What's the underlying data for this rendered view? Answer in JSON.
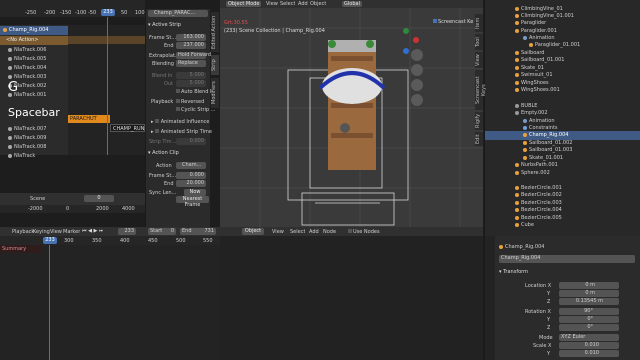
{
  "nla": {
    "ruler": [
      "-250",
      "-200",
      "-150",
      "-100",
      "-50",
      "0",
      "50",
      "100"
    ],
    "frame": "233",
    "tracks": [
      {
        "label": "Champ_Rig.004",
        "type": "object"
      },
      {
        "label": "<No Action>",
        "type": "action"
      },
      {
        "label": "NlaTrack.006",
        "type": "track"
      },
      {
        "label": "NlaTrack.005",
        "type": "track"
      },
      {
        "label": "NlaTrack.004",
        "type": "track"
      },
      {
        "label": "NlaTrack.003",
        "type": "track"
      },
      {
        "label": "NlaTrack.002",
        "type": "track"
      },
      {
        "label": "NlaTrack.001",
        "type": "track"
      },
      {
        "label": "NlaTrack.007",
        "type": "track"
      },
      {
        "label": "NlaTrack.009",
        "type": "track"
      },
      {
        "label": "NlaTrack.008",
        "type": "track"
      },
      {
        "label": "NlaTrack",
        "type": "track"
      }
    ],
    "strips": [
      "PARACHUT",
      "CHAMP_RUN.0"
    ],
    "overlay_g": "G",
    "overlay_space": "Spacebar",
    "bottom": {
      "snap": "Scene",
      "frame": "0",
      "ruler": [
        "-2000",
        "0",
        "2000",
        "4000"
      ]
    }
  },
  "strip_panel": {
    "header": "Champ_PARAC...",
    "active_strip": "Active Strip",
    "frame_start_label": "Frame St...",
    "frame_start": "163.000",
    "end_label": "End",
    "end": "237.000",
    "extrapolate_label": "Extrapolat...",
    "extrapolate": "Hold Forward",
    "blending_label": "Blending",
    "blending": "Replace",
    "blend_in_label": "Blend In",
    "blend_in": "5.000",
    "out_label": "Out",
    "out": "5.000",
    "auto_blend": "Auto Blend I...",
    "playback_label": "Playback",
    "reversed": "Reversed",
    "cyclic": "Cyclic Strip ...",
    "anim_influence": "Animated Influence",
    "anim_strip_time": "Animated Strip Time",
    "strip_time_label": "Strip Tim...",
    "strip_time": "0.000",
    "action_clip": "Action Clip",
    "action_label": "Action",
    "action_value": "Cham...",
    "frame_st2_label": "Frame St...",
    "frame_st2": "0.000",
    "end2_label": "End",
    "end2": "20.000",
    "sync_label": "Sync Len...",
    "now": "Now",
    "tabs": [
      "Edited Action",
      "Strip",
      "Modifiers"
    ],
    "nearest_frame": "Nearest Frame"
  },
  "viewport": {
    "mode": "Object Mode",
    "menus": [
      "View",
      "Select",
      "Add",
      "Object"
    ],
    "global": "Global",
    "info_time": "Grt:30.55",
    "info_line": "(233) Scene Collection | Champ_Rig.004",
    "screencast": "Screencast Ke"
  },
  "node_editor": {
    "type": "Object",
    "menus": [
      "View",
      "Select",
      "Add",
      "Node"
    ],
    "use_nodes": "Use Nodes"
  },
  "timeline": {
    "playback": "Playback",
    "keying": "Keying",
    "view": "View",
    "marker": "Marker",
    "frame": "233",
    "start_label": "Start",
    "start": "0",
    "end_label": "End",
    "end": "731",
    "ruler": [
      "200",
      "300",
      "350",
      "400",
      "450",
      "500",
      "550"
    ],
    "current_label": "233",
    "summary": "Summary"
  },
  "outliner": {
    "items": [
      {
        "label": "ClimbingVine_01",
        "indent": 0
      },
      {
        "label": "ClimbingVine_01.001",
        "indent": 0
      },
      {
        "label": "Paraglider",
        "indent": 0
      },
      {
        "label": "Paraglider.001",
        "indent": 0
      },
      {
        "label": "Animation",
        "indent": 1
      },
      {
        "label": "Paraglider_01.001",
        "indent": 2
      },
      {
        "label": "Sailboard",
        "indent": 0
      },
      {
        "label": "Sailboard_01.001",
        "indent": 0
      },
      {
        "label": "Skate_01",
        "indent": 0
      },
      {
        "label": "Swimsuit_01",
        "indent": 0
      },
      {
        "label": "WingShoes",
        "indent": 0
      },
      {
        "label": "WingShoes.001",
        "indent": 0
      },
      {
        "label": "",
        "indent": 0
      },
      {
        "label": "BUBLE",
        "indent": 0
      },
      {
        "label": "Empty.002",
        "indent": 0
      },
      {
        "label": "Animation",
        "indent": 1
      },
      {
        "label": "Constraints",
        "indent": 1
      },
      {
        "label": "Champ_Rig.004",
        "indent": 1
      },
      {
        "label": "Sailboard_01.002",
        "indent": 1
      },
      {
        "label": "Sailboard_01.003",
        "indent": 1
      },
      {
        "label": "Skate_01.001",
        "indent": 1
      },
      {
        "label": "NurbsPath.001",
        "indent": 0
      },
      {
        "label": "Sphere.002",
        "indent": 0
      },
      {
        "label": "",
        "indent": 0
      },
      {
        "label": "BezierCircle.001",
        "indent": 0
      },
      {
        "label": "BezierCircle.002",
        "indent": 0
      },
      {
        "label": "BezierCircle.003",
        "indent": 0
      },
      {
        "label": "BezierCircle.004",
        "indent": 0
      },
      {
        "label": "BezierCircle.005",
        "indent": 0
      },
      {
        "label": "Cube",
        "indent": 0
      }
    ],
    "selected_index": 17,
    "side_tabs": [
      "Item",
      "Tool",
      "View",
      "Screencast Keys",
      "Rigify",
      "Edit"
    ]
  },
  "properties": {
    "object_name": "Champ_Rig.004",
    "object_field": "Champ_Rig.004",
    "transform": "Transform",
    "location_label": "Location X",
    "loc_x": "0 m",
    "loc_y": "0 m",
    "loc_z": "0.13545 m",
    "rotation_label": "Rotation X",
    "rot_x": "90°",
    "rot_y": "0°",
    "rot_z": "0°",
    "mode_label": "Mode",
    "mode": "XYZ Euler",
    "scale_label": "Scale X",
    "scale_x": "0.010",
    "scale_y": "0.010",
    "scale_z": "0.010",
    "y_label": "Y",
    "z_label": "Z"
  },
  "colors": {
    "selection": "#3f5a84",
    "strip_orange": "#e08a1e",
    "track_blue": "#4f6a90",
    "playhead": "#4772b3"
  }
}
